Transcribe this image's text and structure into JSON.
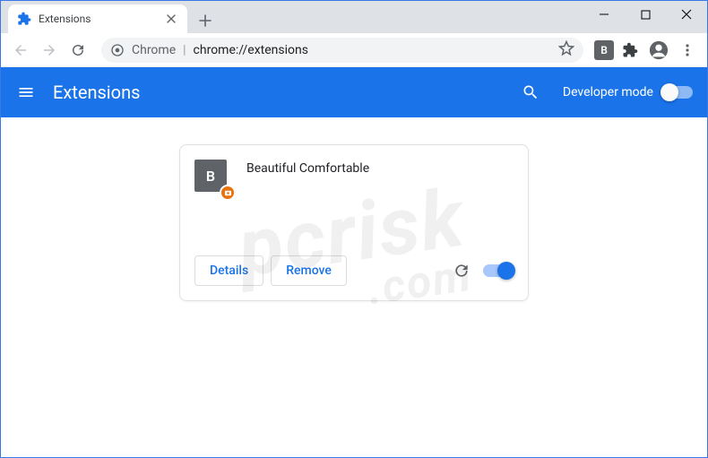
{
  "tab": {
    "title": "Extensions"
  },
  "omnibox": {
    "scheme_label": "Chrome",
    "url_path": "chrome://extensions"
  },
  "toolbar_ext_badge": "B",
  "ext_header": {
    "title": "Extensions",
    "devmode_label": "Developer mode"
  },
  "extension_card": {
    "icon_letter": "B",
    "name": "Beautiful Comfortable",
    "details_label": "Details",
    "remove_label": "Remove",
    "enabled": true
  },
  "watermark": {
    "line1": "pcrisk",
    "line2": ".com"
  }
}
